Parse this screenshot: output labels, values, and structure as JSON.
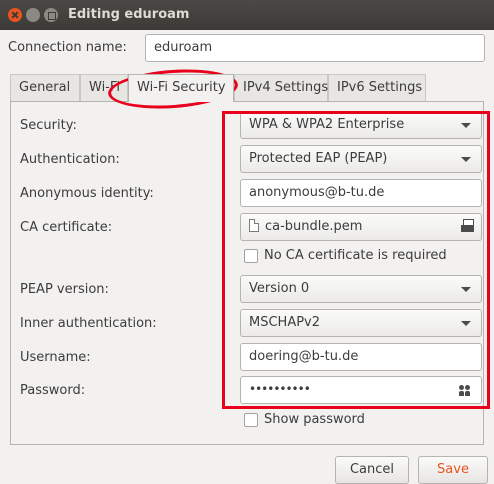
{
  "window": {
    "title": "Editing eduroam"
  },
  "connection": {
    "label": "Connection name:",
    "value": "eduroam"
  },
  "tabs": [
    {
      "label": "General"
    },
    {
      "label": "Wi-Fi"
    },
    {
      "label": "Wi-Fi Security"
    },
    {
      "label": "IPv4 Settings"
    },
    {
      "label": "IPv6 Settings"
    }
  ],
  "security": {
    "label": "Security:",
    "value": "WPA & WPA2 Enterprise"
  },
  "authentication": {
    "label": "Authentication:",
    "value": "Protected EAP (PEAP)"
  },
  "anonymous_identity": {
    "label": "Anonymous identity:",
    "value": "anonymous@b-tu.de"
  },
  "ca_certificate": {
    "label": "CA certificate:",
    "value": "ca-bundle.pem"
  },
  "no_ca_required": {
    "label": "No CA certificate is required",
    "checked": false
  },
  "peap_version": {
    "label": "PEAP version:",
    "value": "Version 0"
  },
  "inner_auth": {
    "label": "Inner authentication:",
    "value": "MSCHAPv2"
  },
  "username": {
    "label": "Username:",
    "value": "doering@b-tu.de"
  },
  "password": {
    "label": "Password:",
    "value": "••••••••••"
  },
  "show_password": {
    "label": "Show password",
    "checked": false
  },
  "buttons": {
    "cancel": "Cancel",
    "save": "Save"
  },
  "colors": {
    "accent": "#e95420",
    "highlight": "#e8001c",
    "titlebar": "#3b3a36"
  }
}
